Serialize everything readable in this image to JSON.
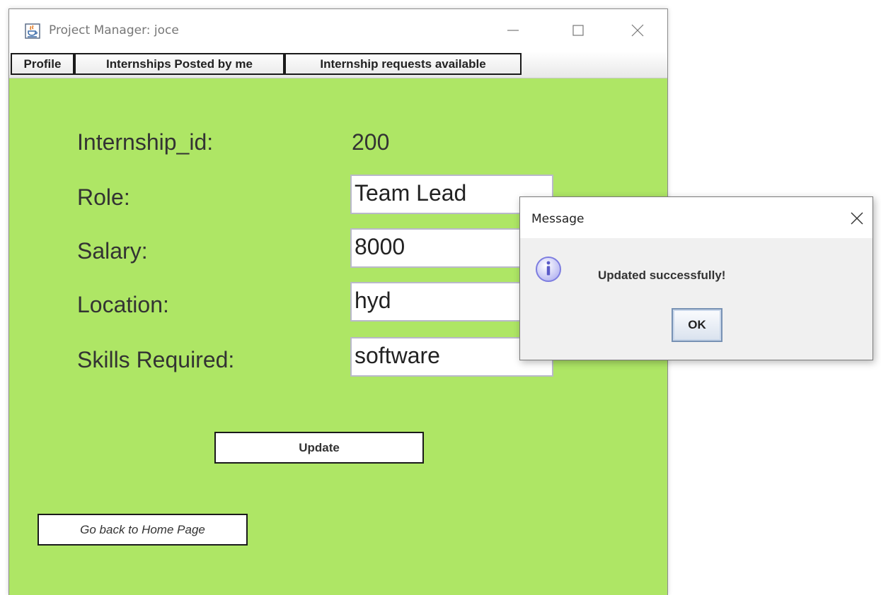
{
  "window": {
    "title": "Project Manager: joce",
    "icon": "java-coffee-cup-icon"
  },
  "menu": {
    "items": [
      {
        "label": "Profile"
      },
      {
        "label": "Internships Posted by me"
      },
      {
        "label": "Internship requests available"
      }
    ]
  },
  "form": {
    "id_label": "Internship_id:",
    "id_value": "200",
    "role_label": "Role:",
    "role_value": "Team Lead",
    "salary_label": "Salary:",
    "salary_value": "8000",
    "location_label": "Location:",
    "location_value": "hyd",
    "skills_label": "Skills Required:",
    "skills_value": "software",
    "update_label": "Update",
    "home_label": "Go back to Home Page"
  },
  "dialog": {
    "title": "Message",
    "message": "Updated successfully!",
    "ok_label": "OK",
    "icon": "information-icon"
  },
  "colors": {
    "content_background": "#aee665",
    "ok_border": "#7892b4",
    "info_icon": "#7d7de0"
  }
}
